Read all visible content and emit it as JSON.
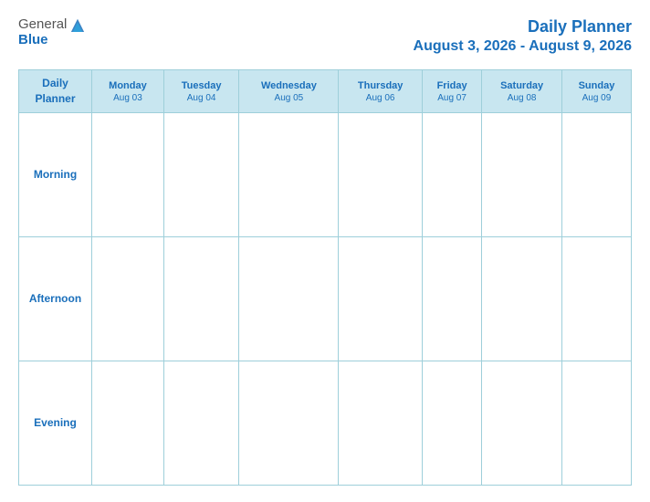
{
  "header": {
    "logo": {
      "general": "General",
      "blue": "Blue",
      "tagline": ""
    },
    "title": "Daily Planner",
    "date_range": "August 3, 2026 - August 9, 2026"
  },
  "table": {
    "label_col": {
      "line1": "Daily",
      "line2": "Planner"
    },
    "columns": [
      {
        "day": "Monday",
        "date": "Aug 03"
      },
      {
        "day": "Tuesday",
        "date": "Aug 04"
      },
      {
        "day": "Wednesday",
        "date": "Aug 05"
      },
      {
        "day": "Thursday",
        "date": "Aug 06"
      },
      {
        "day": "Friday",
        "date": "Aug 07"
      },
      {
        "day": "Saturday",
        "date": "Aug 08"
      },
      {
        "day": "Sunday",
        "date": "Aug 09"
      }
    ],
    "rows": [
      {
        "label": "Morning"
      },
      {
        "label": "Afternoon"
      },
      {
        "label": "Evening"
      }
    ]
  }
}
